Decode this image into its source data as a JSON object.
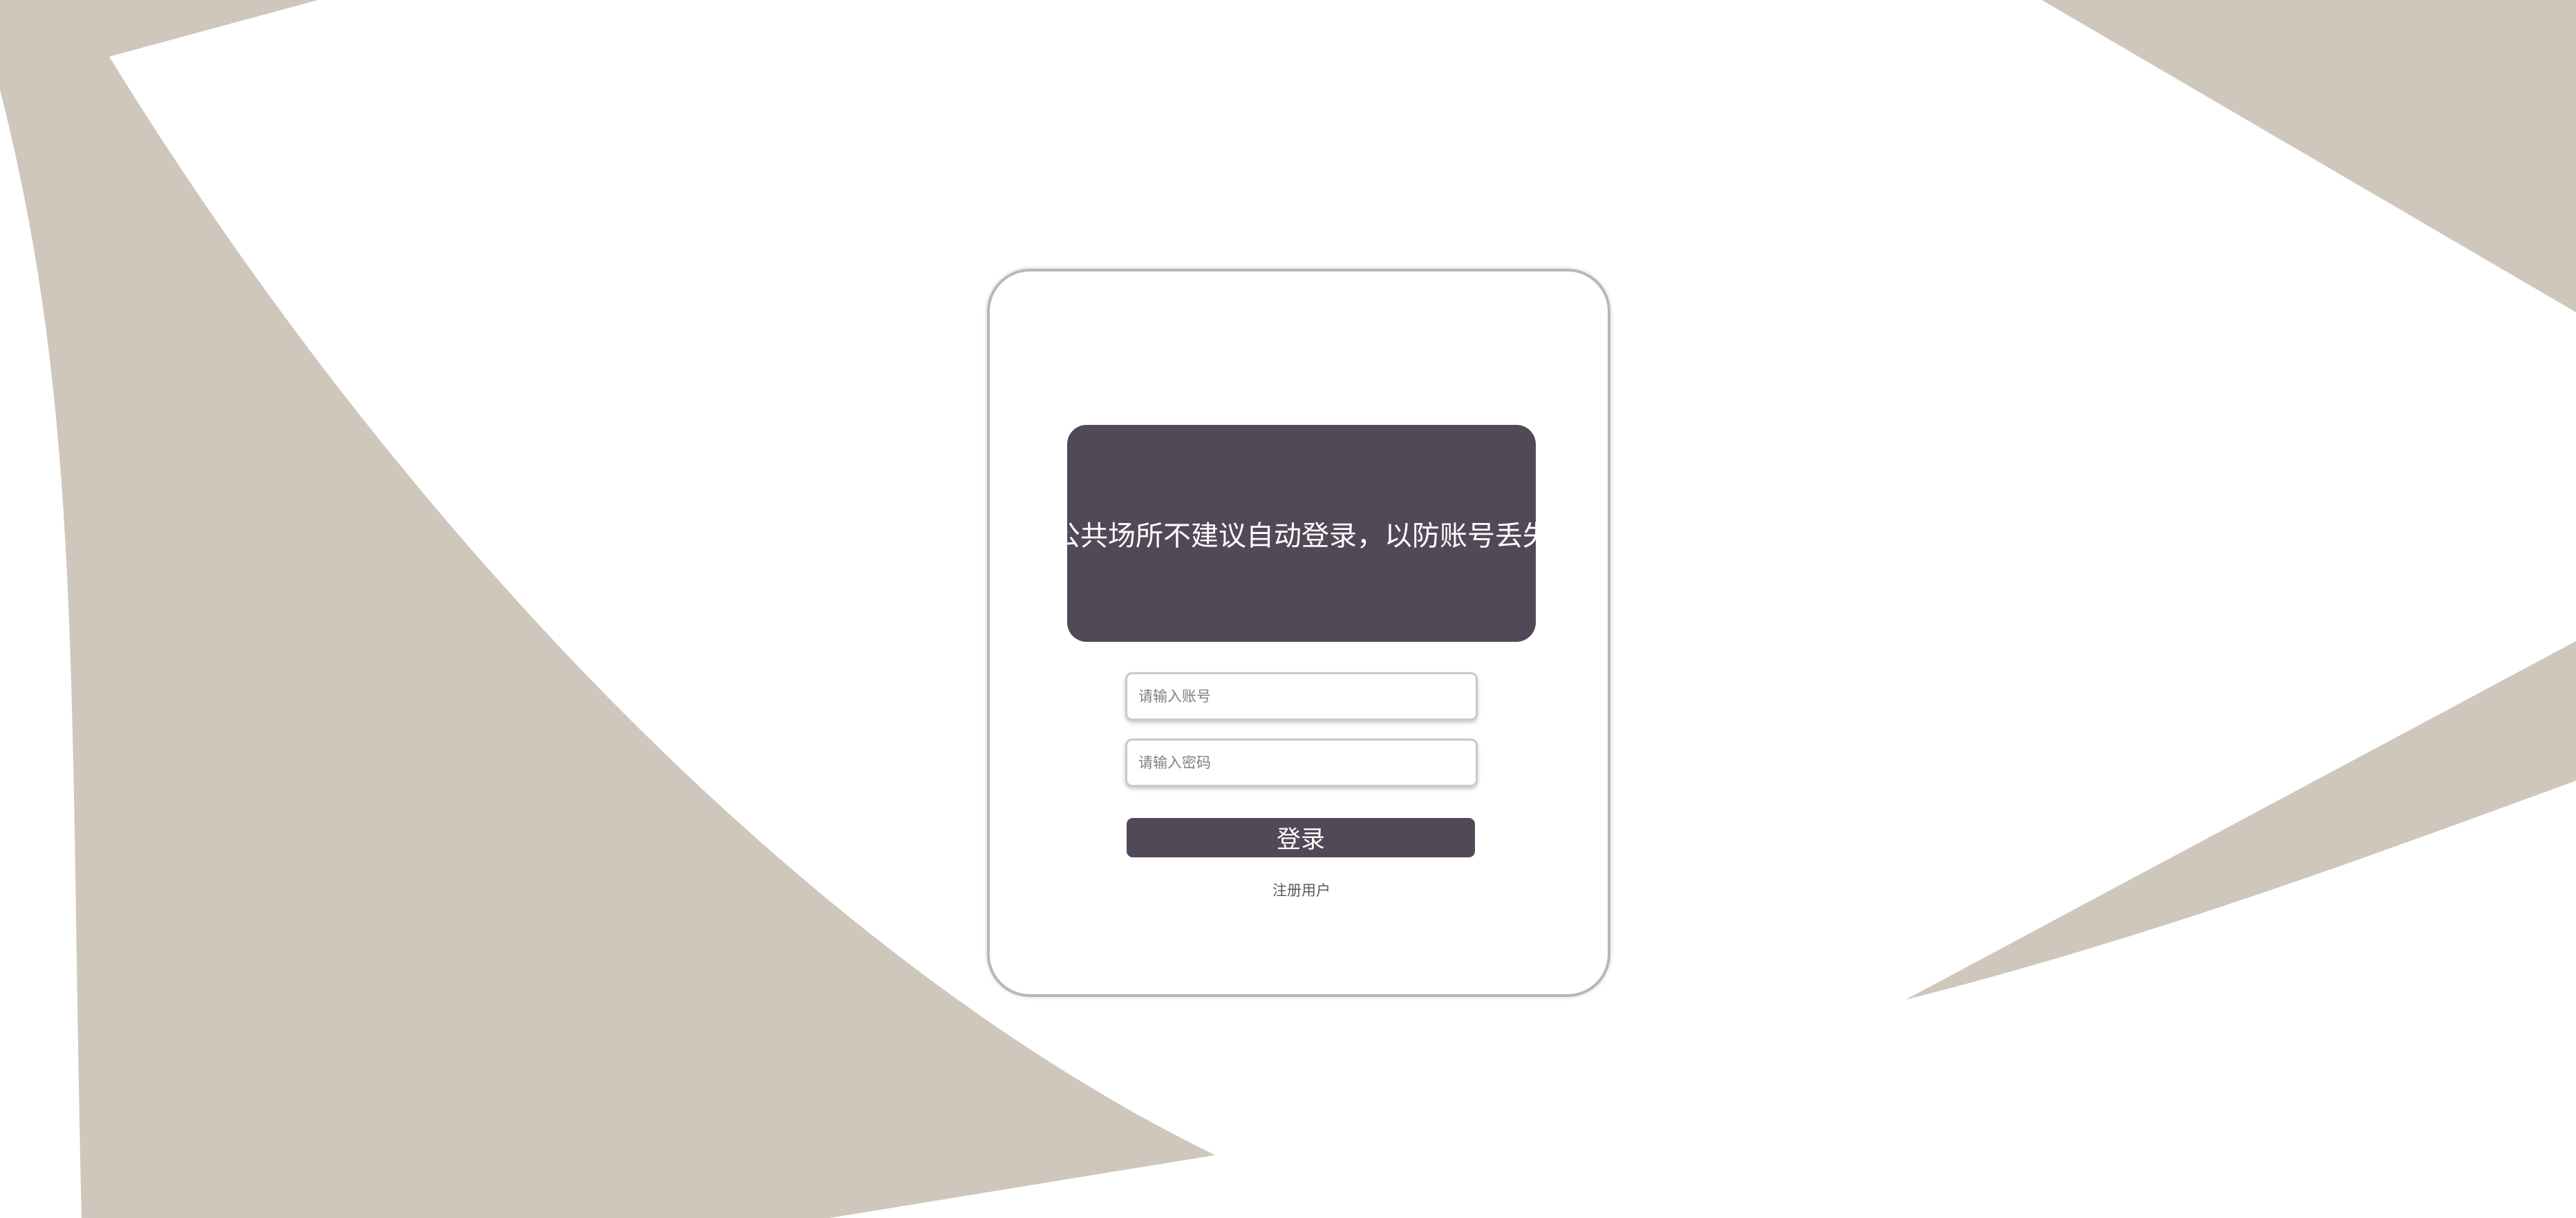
{
  "colors": {
    "background": "#ffffff",
    "background_shape": "#cfc6bc",
    "accent": "#514957",
    "card_border": "#b8b8b8"
  },
  "notice": {
    "text": "公共场所不建议自动登录，以防账号丢失"
  },
  "form": {
    "account_placeholder": "请输入账号",
    "password_placeholder": "请输入密码",
    "login_label": "登录",
    "register_label": "注册用户"
  }
}
